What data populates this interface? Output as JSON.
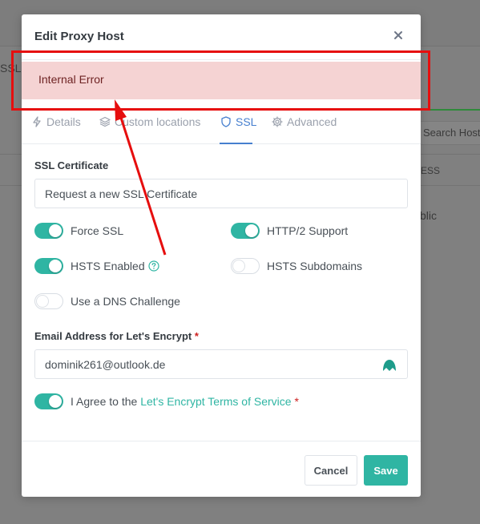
{
  "background": {
    "snippet_ssl": "SSL",
    "snippet_search": "Search Host",
    "snippet_access": "ESS",
    "snippet_public": "blic"
  },
  "modal": {
    "title": "Edit Proxy Host",
    "alert_text": "Internal Error",
    "tabs": [
      {
        "label": "Details",
        "icon": "bolt-icon"
      },
      {
        "label": "Custom locations",
        "icon": "layers-icon"
      },
      {
        "label": "SSL",
        "icon": "shield-icon"
      },
      {
        "label": "Advanced",
        "icon": "gear-icon"
      }
    ],
    "active_tab": "SSL",
    "ssl_certificate_label": "SSL Certificate",
    "ssl_certificate_value": "Request a new SSL Certificate",
    "toggles": {
      "force_ssl": {
        "label": "Force SSL",
        "on": true
      },
      "http2": {
        "label": "HTTP/2 Support",
        "on": true
      },
      "hsts": {
        "label": "HSTS Enabled",
        "on": true
      },
      "hsts_sub": {
        "label": "HSTS Subdomains",
        "on": false
      },
      "dns": {
        "label": "Use a DNS Challenge",
        "on": false
      }
    },
    "email_label": "Email Address for Let's Encrypt",
    "required_mark": "*",
    "email_value": "dominik261@outlook.de",
    "agree_prefix": "I Agree to the",
    "agree_link": "Let's Encrypt Terms of Service",
    "agree_on": true,
    "cancel_label": "Cancel",
    "save_label": "Save"
  },
  "colors": {
    "accent": "#2fb5a3",
    "tab_active": "#467fcf",
    "alert_bg": "#f5d3d3",
    "annotation": "#e60e0e"
  }
}
